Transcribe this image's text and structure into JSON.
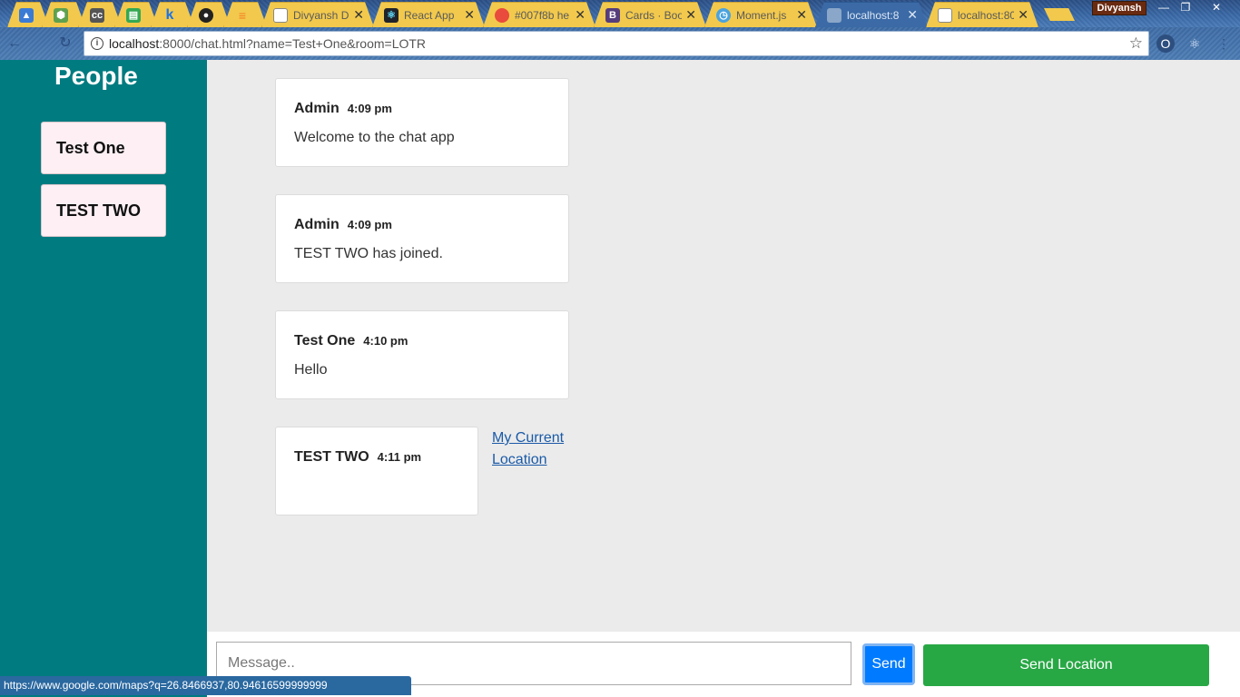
{
  "browser": {
    "tabs": [
      {
        "label": "",
        "icon": "mortarboard-icon",
        "color": "#3a7bd5"
      },
      {
        "label": "",
        "icon": "nodejs-icon",
        "color": "#5fa04e"
      },
      {
        "label": "",
        "icon": "cc-icon",
        "color": "#555555"
      },
      {
        "label": "",
        "icon": "drive-icon",
        "color": "#34a853"
      },
      {
        "label": "",
        "icon": "k-icon",
        "color": "#1a73e8"
      },
      {
        "label": "",
        "icon": "github-icon",
        "color": "#222222"
      },
      {
        "label": "",
        "icon": "stackoverflow-icon",
        "color": "#f48024"
      },
      {
        "label": "Divyansh D",
        "icon": "page-icon",
        "color": "#888888"
      },
      {
        "label": "React App",
        "icon": "react-icon",
        "color": "#20232a"
      },
      {
        "label": "#007f8b he",
        "icon": "color-icon",
        "color": "#e94b3c"
      },
      {
        "label": "Cards · Boo",
        "icon": "bootstrap-icon",
        "color": "#563d7c"
      },
      {
        "label": "Moment.js",
        "icon": "clock-icon",
        "color": "#4aa3df"
      },
      {
        "label": "localhost:8",
        "icon": "page-icon",
        "color": "#8aa6c8"
      },
      {
        "label": "localhost:80",
        "icon": "page-icon",
        "color": "#888888"
      }
    ],
    "profile": "Divyansh",
    "url_host": "localhost",
    "url_rest": ":8000/chat.html?name=Test+One&room=LOTR",
    "status_url": "https://www.google.com/maps?q=26.8466937,80.94616599999999"
  },
  "sidebar": {
    "title": "People",
    "people": [
      "Test One",
      "TEST TWO"
    ]
  },
  "messages": [
    {
      "sender": "Admin",
      "time": "4:09 pm",
      "text": "Welcome to the chat app"
    },
    {
      "sender": "Admin",
      "time": "4:09 pm",
      "text": "TEST TWO has joined."
    },
    {
      "sender": "Test One",
      "time": "4:10 pm",
      "text": "Hello"
    },
    {
      "sender": "TEST TWO",
      "time": "4:11 pm",
      "text": ""
    }
  ],
  "location_link": "My Current Location",
  "footer": {
    "placeholder": "Message..",
    "send_label": "Send",
    "location_label": "Send Location"
  },
  "colors": {
    "sidebar": "#007b80",
    "send": "#007bff",
    "location": "#28a745"
  }
}
